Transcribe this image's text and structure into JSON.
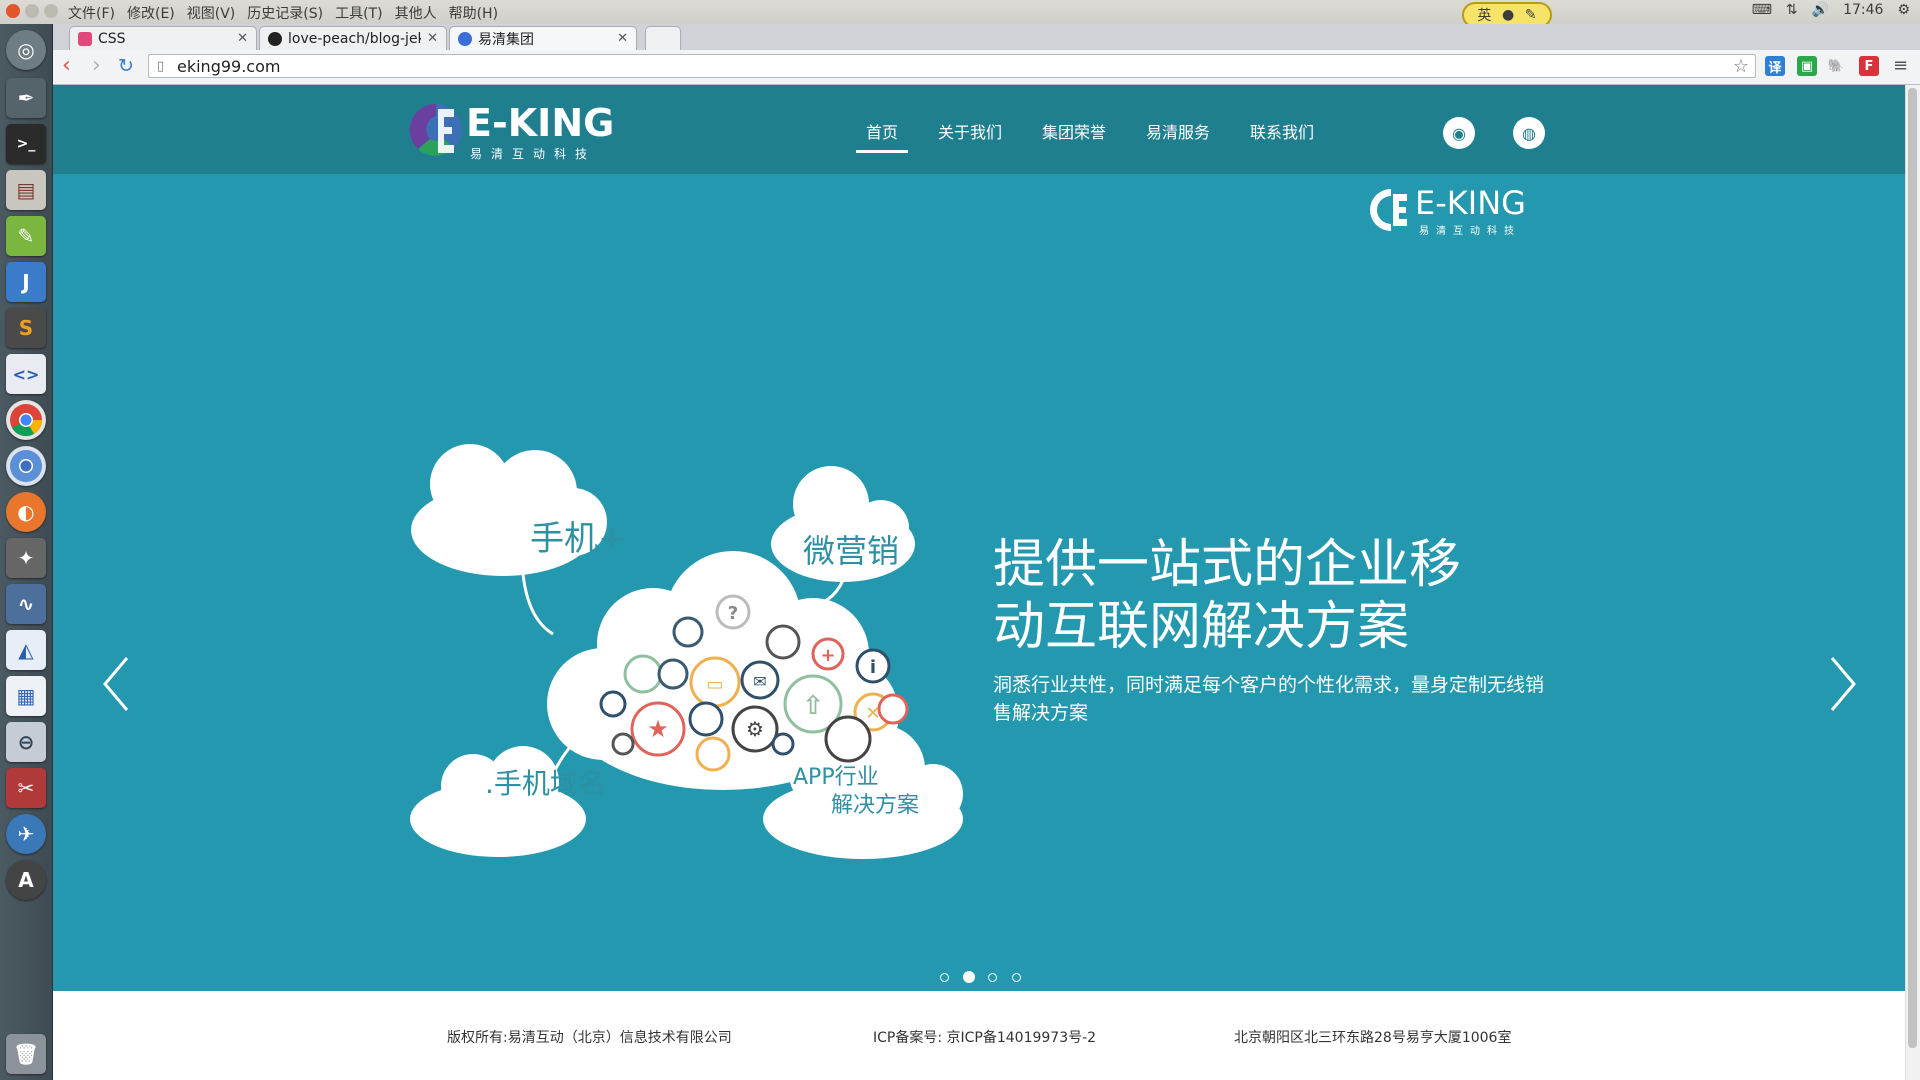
{
  "system": {
    "menu": [
      "文件(F)",
      "修改(E)",
      "视图(V)",
      "历史记录(S)",
      "工具(T)",
      "其他人",
      "帮助(H)"
    ],
    "ime_label": "英",
    "clock": "17:46"
  },
  "browser": {
    "tabs": [
      {
        "label": "CSS",
        "color": "#e0487b"
      },
      {
        "label": "love-peach/blog-jek",
        "color": "#222222"
      },
      {
        "label": "易清集团",
        "color": "#3a6fd8"
      }
    ],
    "url": "eking99.com"
  },
  "site": {
    "logo": {
      "name": "E-KING",
      "sub": "易清互动科技"
    },
    "nav": [
      "首页",
      "关于我们",
      "集团荣誉",
      "易清服务",
      "联系我们"
    ],
    "active_nav": "首页",
    "hero": {
      "headline_line1": "提供一站式的企业移",
      "headline_line2": "动互联网解决方案",
      "subline": "洞悉行业共性，同时满足每个客户的个性化需求，量身定制无线销售解决方案",
      "clouds": {
        "top_left": "手机+",
        "top_right": "微营销",
        "bottom_left": ".手机域名",
        "bottom_right_line1": "APP行业",
        "bottom_right_line2": "解决方案"
      },
      "slide_count": 4,
      "active_slide": 2
    },
    "footer": {
      "copyright": "版权所有:易清互动（北京）信息技术有限公司",
      "icp": "ICP备案号: 京ICP备14019973号-2",
      "address": "北京朝阳区北三环东路28号易亨大厦1006室"
    },
    "colors": {
      "header": "#207f8f",
      "hero": "#2398ae",
      "cloud_text": "#2f8fa3"
    }
  }
}
